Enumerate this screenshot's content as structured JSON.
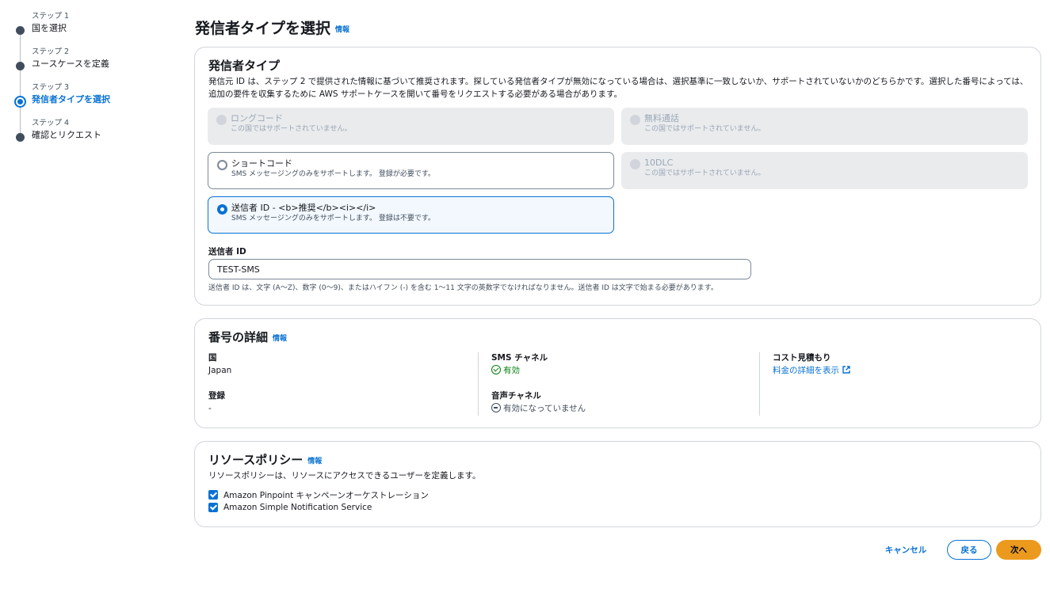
{
  "steps": [
    {
      "num": "ステップ 1",
      "title": "国を選択"
    },
    {
      "num": "ステップ 2",
      "title": "ユースケースを定義"
    },
    {
      "num": "ステップ 3",
      "title": "発信者タイプを選択"
    },
    {
      "num": "ステップ 4",
      "title": "確認とリクエスト"
    }
  ],
  "header": {
    "title": "発信者タイプを選択",
    "info": "情報"
  },
  "originator": {
    "title": "発信者タイプ",
    "description": "発信元 ID は、ステップ 2 で提供された情報に基づいて推奨されます。探している発信者タイプが無効になっている場合は、選択基準に一致しないか、サポートされていないかのどちらかです。選択した番号によっては、追加の要件を収集するために AWS サポートケースを開いて番号をリクエストする必要がある場合があります。",
    "options": [
      {
        "title": "ロングコード",
        "sub": "この国ではサポートされていません。",
        "state": "disabled"
      },
      {
        "title": "無料通話",
        "sub": "この国ではサポートされていません。",
        "state": "disabled"
      },
      {
        "title": "ショートコード",
        "sub": "SMS メッセージングのみをサポートします。 登録が必要です。",
        "state": "normal"
      },
      {
        "title": "10DLC",
        "sub": "この国ではサポートされていません。",
        "state": "disabled"
      },
      {
        "title": "送信者 ID - <b>推奨</b><i></i>",
        "sub": "SMS メッセージングのみをサポートします。 登録は不要です。",
        "state": "selected"
      }
    ],
    "sender_id_label": "送信者 ID",
    "sender_id_value": "TEST-SMS",
    "sender_id_hint": "送信者 ID は、文字 (A〜Z)、数字 (0〜9)、またはハイフン (-) を含む 1〜11 文字の英数字でなければなりません。送信者 ID は文字で始まる必要があります。"
  },
  "details": {
    "title": "番号の詳細",
    "info": "情報",
    "country_label": "国",
    "country_value": "Japan",
    "registration_label": "登録",
    "registration_value": "-",
    "sms_label": "SMS チャネル",
    "sms_value": "有効",
    "voice_label": "音声チャネル",
    "voice_value": "有効になっていません",
    "cost_label": "コスト見積もり",
    "cost_link": "料金の詳細を表示"
  },
  "policy": {
    "title": "リソースポリシー",
    "info": "情報",
    "description": "リソースポリシーは、リソースにアクセスできるユーザーを定義します。",
    "items": [
      {
        "label": "Amazon Pinpoint キャンペーンオーケストレーション",
        "checked": true
      },
      {
        "label": "Amazon Simple Notification Service",
        "checked": true
      }
    ]
  },
  "footer": {
    "cancel": "キャンセル",
    "back": "戻る",
    "next": "次へ"
  },
  "colors": {
    "accent": "#0972d3",
    "primary_button": "#ec9a1d",
    "success": "#037f0c"
  }
}
